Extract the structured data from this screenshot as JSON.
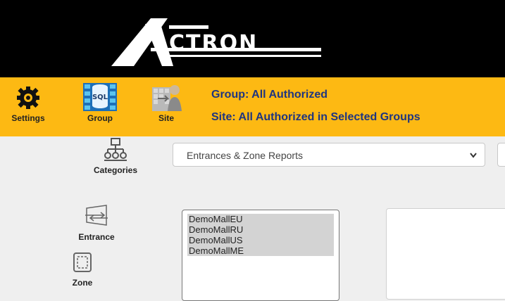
{
  "header": {
    "logo_text": "CTRON"
  },
  "nav": {
    "settings_label": "Settings",
    "group_label": "Group",
    "site_label": "Site",
    "group_info": "Group:  All Authorized",
    "site_info": "Site:  All Authorized in Selected Groups",
    "accent_color": "#fdb913"
  },
  "sidebar": {
    "categories_label": "Categories",
    "entrance_label": "Entrance",
    "zone_label": "Zone"
  },
  "report_select": {
    "value": "Entrances & Zone Reports"
  },
  "site_list": {
    "options": [
      "DemoMallEU",
      "DemoMallRU",
      "DemoMallUS",
      "DemoMallME"
    ]
  }
}
